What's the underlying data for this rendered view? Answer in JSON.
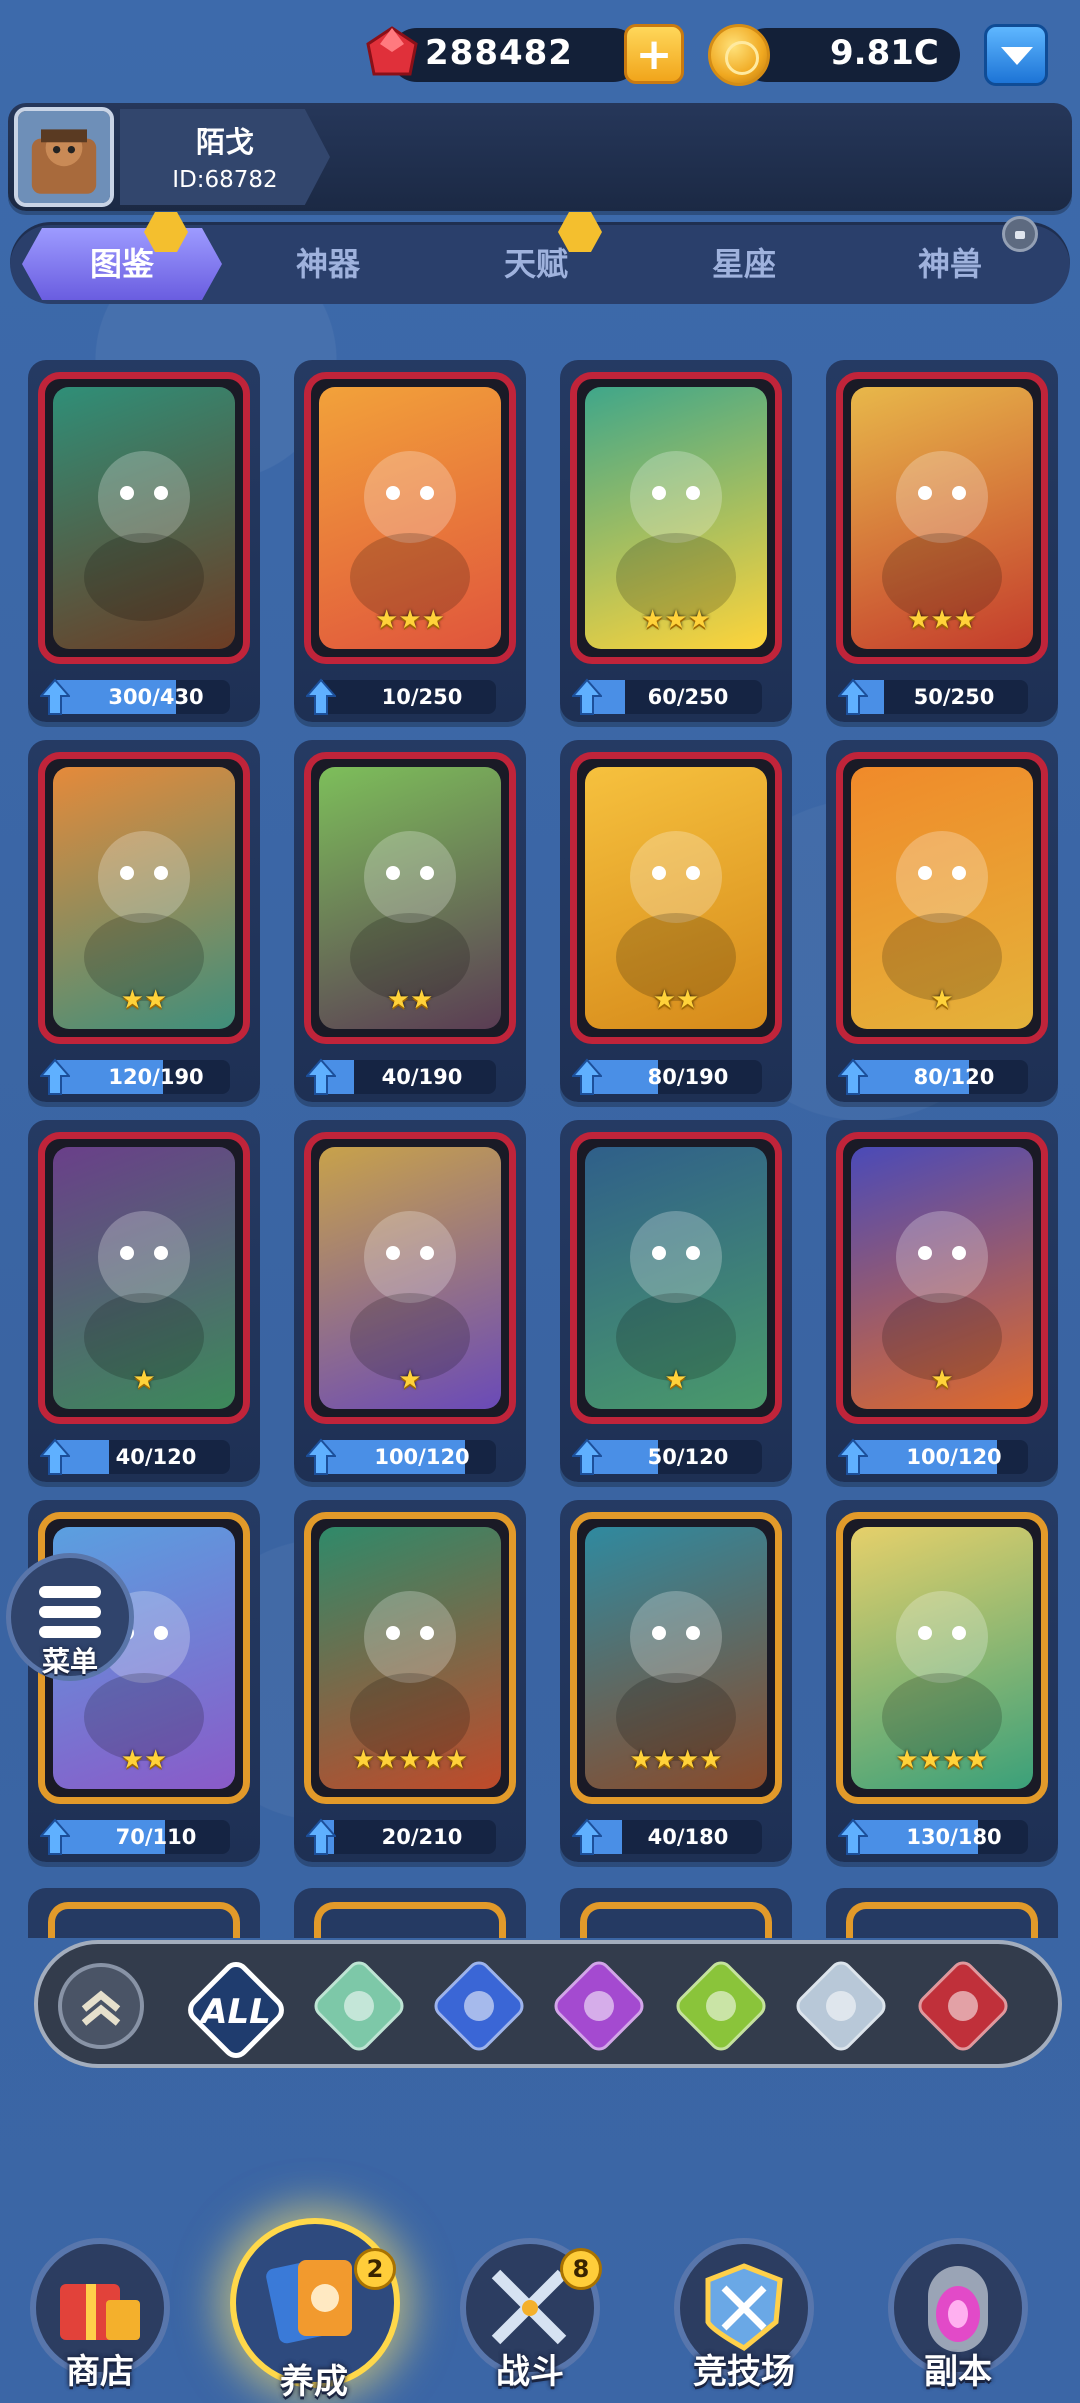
{
  "player": {
    "name": "陌戈",
    "id": "ID:68782"
  },
  "currency": {
    "gems": "288482",
    "coins": "9.81C"
  },
  "tabs": [
    {
      "label": "图鉴",
      "active": true
    },
    {
      "label": "神器"
    },
    {
      "label": "天赋"
    },
    {
      "label": "星座"
    },
    {
      "label": "神兽"
    }
  ],
  "cards": [
    {
      "progress": "300/430",
      "fill": 0.7,
      "stars": "",
      "frame": "red"
    },
    {
      "progress": "10/250",
      "fill": 0.04,
      "stars": "★★★",
      "frame": "red"
    },
    {
      "progress": "60/250",
      "fill": 0.24,
      "stars": "★★★",
      "frame": "red"
    },
    {
      "progress": "50/250",
      "fill": 0.2,
      "stars": "★★★",
      "frame": "red"
    },
    {
      "progress": "120/190",
      "fill": 0.63,
      "stars": "★★",
      "frame": "red"
    },
    {
      "progress": "40/190",
      "fill": 0.21,
      "stars": "★★",
      "frame": "red"
    },
    {
      "progress": "80/190",
      "fill": 0.42,
      "stars": "★★",
      "frame": "red"
    },
    {
      "progress": "80/120",
      "fill": 0.67,
      "stars": "★",
      "frame": "red"
    },
    {
      "progress": "40/120",
      "fill": 0.33,
      "stars": "★",
      "frame": "red"
    },
    {
      "progress": "100/120",
      "fill": 0.83,
      "stars": "★",
      "frame": "red"
    },
    {
      "progress": "50/120",
      "fill": 0.42,
      "stars": "★",
      "frame": "red"
    },
    {
      "progress": "100/120",
      "fill": 0.83,
      "stars": "★",
      "frame": "red"
    },
    {
      "progress": "70/110",
      "fill": 0.64,
      "stars": "★★",
      "frame": "gold"
    },
    {
      "progress": "20/210",
      "fill": 0.1,
      "stars": "★★★★★",
      "frame": "gold"
    },
    {
      "progress": "40/180",
      "fill": 0.22,
      "stars": "★★★★",
      "frame": "gold"
    },
    {
      "progress": "130/180",
      "fill": 0.72,
      "stars": "★★★★",
      "frame": "gold"
    }
  ],
  "filters": {
    "all_label": "ALL",
    "icons": [
      "tag-icon",
      "orb-icon",
      "wing-icon",
      "lotus-icon",
      "prism-icon",
      "bat-icon"
    ]
  },
  "menu": {
    "label": "菜单"
  },
  "nav": [
    {
      "label": "商店"
    },
    {
      "label": "养成",
      "badge": "2",
      "active": true
    },
    {
      "label": "战斗",
      "badge": "8"
    },
    {
      "label": "竞技场"
    },
    {
      "label": "副本"
    }
  ],
  "colors": {
    "accent": "#7b6ef0",
    "frame_red": "#c0243a",
    "frame_gold": "#e29a2a",
    "progress": "#4a8fe6"
  }
}
